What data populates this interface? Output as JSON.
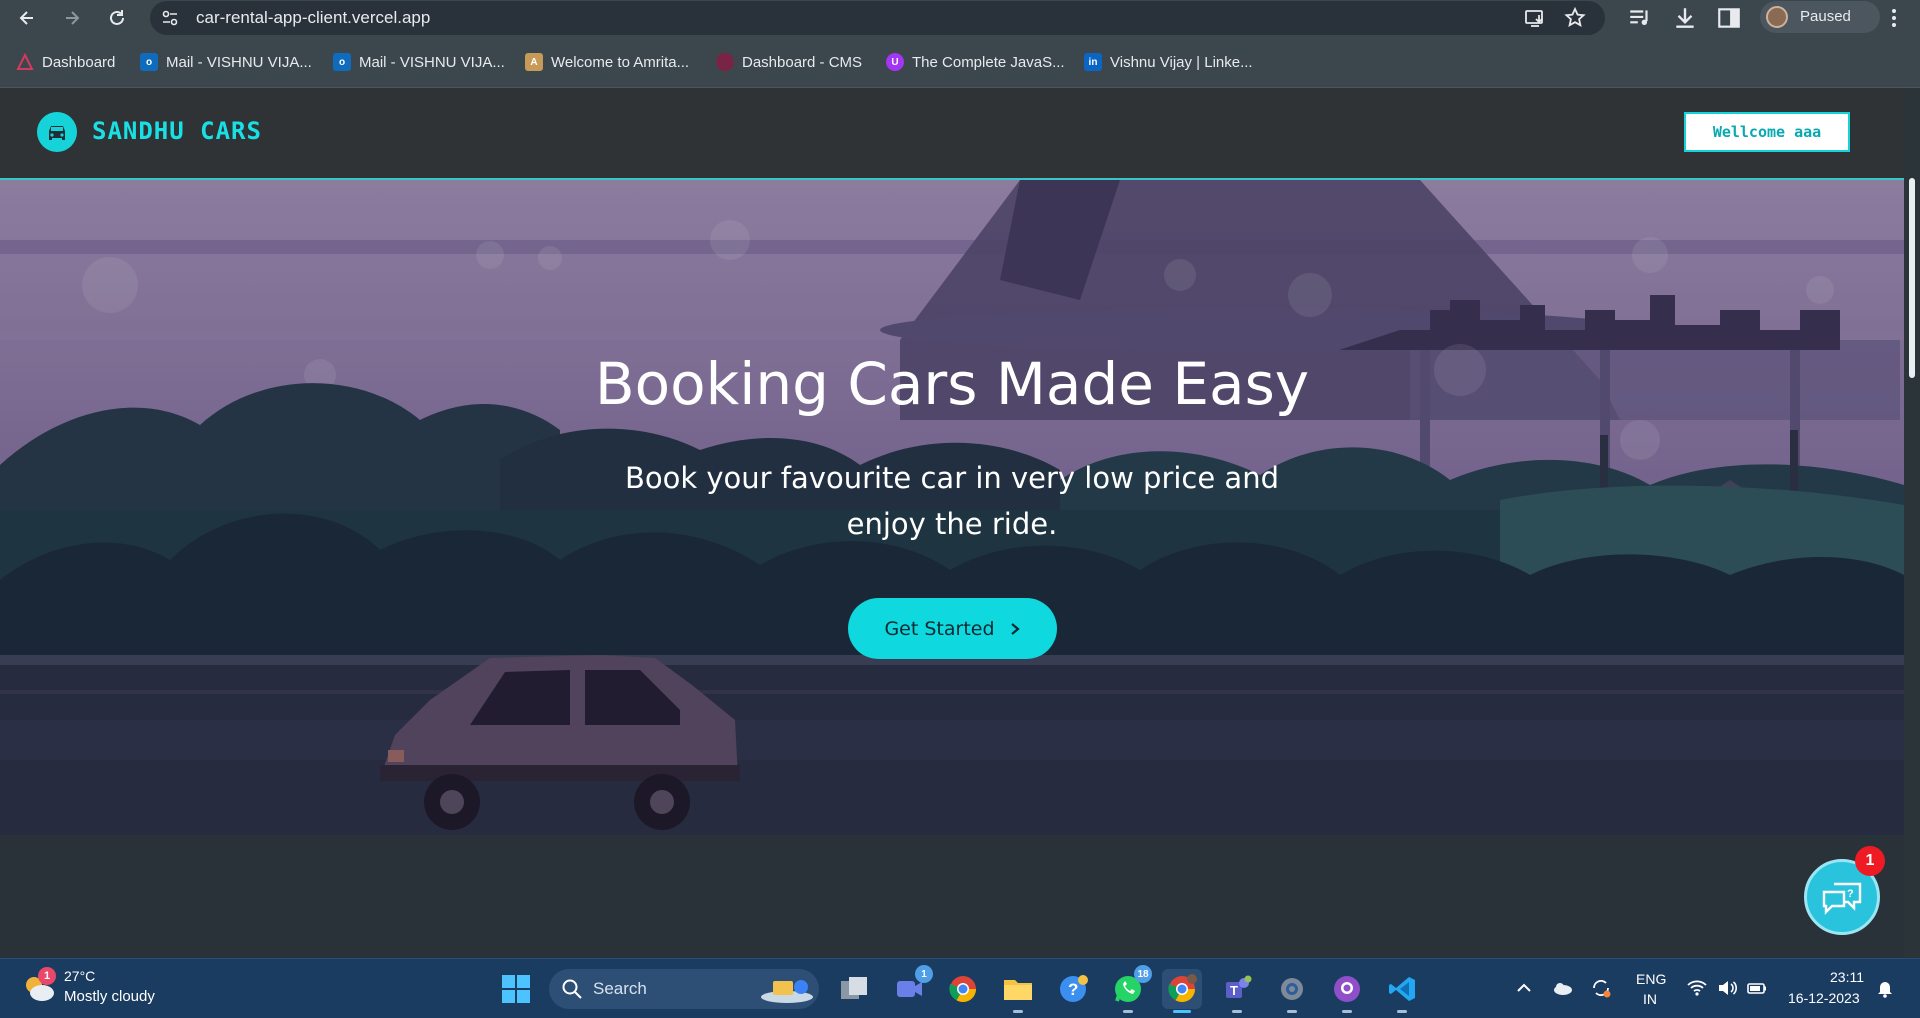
{
  "browser": {
    "url": "car-rental-app-client.vercel.app",
    "profile_status": "Paused",
    "bookmarks": [
      {
        "label": "Dashboard",
        "icon": "amrita-triangle-icon"
      },
      {
        "label": "Mail - VISHNU VIJA...",
        "icon": "outlook-icon"
      },
      {
        "label": "Mail - VISHNU VIJA...",
        "icon": "outlook-icon"
      },
      {
        "label": "Welcome to Amrita...",
        "icon": "amrita-site-icon"
      },
      {
        "label": "Dashboard - CMS",
        "icon": "cms-icon"
      },
      {
        "label": "The Complete JavaS...",
        "icon": "udemy-icon"
      },
      {
        "label": "Vishnu Vijay | Linke...",
        "icon": "linkedin-icon"
      }
    ]
  },
  "site": {
    "brand": "SANDHU CARS",
    "welcome_label": "Wellcome aaa",
    "hero": {
      "title": "Booking Cars Made Easy",
      "subtitle": "Book your favourite car in very low price and enjoy the ride.",
      "cta_label": "Get Started"
    },
    "chat_badge": "1"
  },
  "taskbar": {
    "weather": {
      "temp": "27°C",
      "condition": "Mostly cloudy",
      "badge": "1"
    },
    "search_placeholder": "Search",
    "apps": [
      {
        "name": "task-view",
        "badge": ""
      },
      {
        "name": "teams-meet",
        "badge": "1"
      },
      {
        "name": "chrome",
        "badge": ""
      },
      {
        "name": "file-explorer",
        "badge": ""
      },
      {
        "name": "get-help",
        "badge": ""
      },
      {
        "name": "whatsapp",
        "badge": "18"
      },
      {
        "name": "chrome-profile",
        "badge": ""
      },
      {
        "name": "teams",
        "badge": ""
      },
      {
        "name": "settings",
        "badge": ""
      },
      {
        "name": "github-desktop",
        "badge": ""
      },
      {
        "name": "vscode",
        "badge": ""
      }
    ],
    "language_1": "ENG",
    "language_2": "IN",
    "time": "23:11",
    "date": "16-12-2023"
  },
  "colors": {
    "accent": "#0fd8de",
    "header_bg": "#2f3336",
    "hero_sky": "#8e7aa6",
    "taskbar_bg": "#1b3c61"
  }
}
